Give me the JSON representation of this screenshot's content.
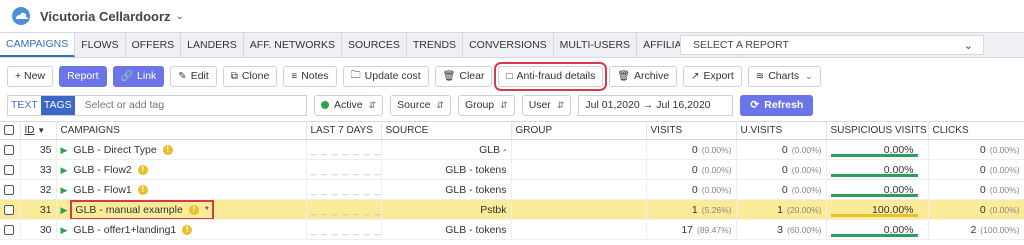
{
  "account": {
    "name": "Vicutoria Cellardoorz"
  },
  "tabs": [
    "CAMPAIGNS",
    "FLOWS",
    "OFFERS",
    "LANDERS",
    "AFF. NETWORKS",
    "SOURCES",
    "TRENDS",
    "CONVERSIONS",
    "MULTI-USERS",
    "AFFILIATE PANEL"
  ],
  "report_select": "SELECT A REPORT",
  "toolbar": {
    "new": "+ New",
    "report": "Report",
    "link": "Link",
    "edit": "Edit",
    "clone": "Clone",
    "notes": "Notes",
    "update_cost": "Update cost",
    "clear": "Clear",
    "antifraud": "Anti-fraud details",
    "archive": "Archive",
    "export": "Export",
    "charts": "Charts"
  },
  "filters": {
    "text": "TEXT",
    "tags": "TAGS",
    "tag_placeholder": "Select or add tag",
    "status": "Active",
    "source": "Source",
    "group": "Group",
    "user": "User",
    "date_from": "Jul 01,2020",
    "date_to": "Jul 16,2020",
    "refresh": "Refresh"
  },
  "columns": [
    "ID",
    "CAMPAIGNS",
    "LAST 7 DAYS",
    "SOURCE",
    "GROUP",
    "VISITS",
    "U.VISITS",
    "SUSPICIOUS VISITS",
    "CLICKS"
  ],
  "rows": [
    {
      "id": "35",
      "name": "GLB - Direct Type",
      "last7": "_ _ _ _ _ _ _ _",
      "source": "GLB -",
      "group": "",
      "visits": "0",
      "visits_pct": "(0.00%)",
      "uvisits": "0",
      "uvisits_pct": "(0.00%)",
      "susp": "0.00%",
      "susp_level": 0,
      "clicks": "0",
      "clicks_pct": "(0.00%)",
      "star": ""
    },
    {
      "id": "33",
      "name": "GLB - Flow2",
      "last7": "_ _ _ _ _ _ _ _",
      "source": "GLB - tokens",
      "group": "",
      "visits": "0",
      "visits_pct": "(0.00%)",
      "uvisits": "0",
      "uvisits_pct": "(0.00%)",
      "susp": "0.00%",
      "susp_level": 0,
      "clicks": "0",
      "clicks_pct": "(0.00%)",
      "star": ""
    },
    {
      "id": "32",
      "name": "GLB - Flow1",
      "last7": "_ _ _ _ _ _ _ _",
      "source": "GLB - tokens",
      "group": "",
      "visits": "0",
      "visits_pct": "(0.00%)",
      "uvisits": "0",
      "uvisits_pct": "(0.00%)",
      "susp": "0.00%",
      "susp_level": 0,
      "clicks": "0",
      "clicks_pct": "(0.00%)",
      "star": ""
    },
    {
      "id": "31",
      "name": "GLB - manual example",
      "last7": "_ _ _ _ _ _ _ _",
      "source": "Pstbk",
      "group": "",
      "visits": "1",
      "visits_pct": "(5.26%)",
      "uvisits": "1",
      "uvisits_pct": "(20.00%)",
      "susp": "100.00%",
      "susp_level": 1,
      "clicks": "0",
      "clicks_pct": "(0.00%)",
      "star": "*"
    },
    {
      "id": "30",
      "name": "GLB - offer1+landing1",
      "last7": "_ _ _ _ _ _ _ _",
      "source": "GLB - tokens",
      "group": "",
      "visits": "17",
      "visits_pct": "(89.47%)",
      "uvisits": "3",
      "uvisits_pct": "(60.00%)",
      "susp": "0.00%",
      "susp_level": 0,
      "clicks": "2",
      "clicks_pct": "(100.00%)",
      "star": ""
    }
  ]
}
